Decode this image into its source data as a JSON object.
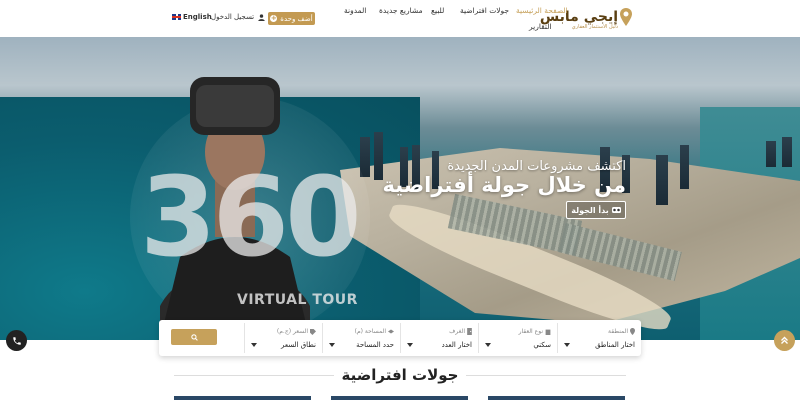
{
  "header": {
    "logo_text": "إيجي مابس",
    "logo_sub": "دليل الاستثمار العقاري",
    "nav": {
      "home": "الصفحة الرئيسية",
      "virtual_tours": "جولات افتراضية",
      "for_sale": "للبيع",
      "new_projects": "مشاريع جديدة",
      "blog": "المدونة",
      "reports": "التقارير"
    },
    "add_unit": "أضف وحدة",
    "login": "تسجيل الدخول",
    "language": "English"
  },
  "hero": {
    "subtitle": "اكتشف مشروعات المدن الجديدة",
    "title": "من خلال جولة أفتراضية",
    "start_button": "بدأ الجولة",
    "badge_number": "360",
    "badge_text": "VIRTUAL TOUR"
  },
  "search": {
    "region": {
      "label": "المنطقة",
      "value": "اختار المناطق"
    },
    "property_type": {
      "label": "نوع العقار",
      "value": "سكني"
    },
    "rooms": {
      "label": "الغرف",
      "value": "اختار العدد"
    },
    "area": {
      "label": "المساحة (م)",
      "value": "حدد المساحة"
    },
    "price": {
      "label": "السعر (ج.م)",
      "value": "نطاق السعر"
    }
  },
  "section": {
    "title": "جولات افتراضية"
  },
  "colors": {
    "accent": "#c6a15b",
    "dark": "#222222"
  },
  "icons": {
    "plus": "plus-circle-icon",
    "user": "user-icon",
    "vr": "vr-headset-icon",
    "search": "search-icon",
    "phone": "phone-icon",
    "scroll_top": "double-chevron-up-icon"
  }
}
